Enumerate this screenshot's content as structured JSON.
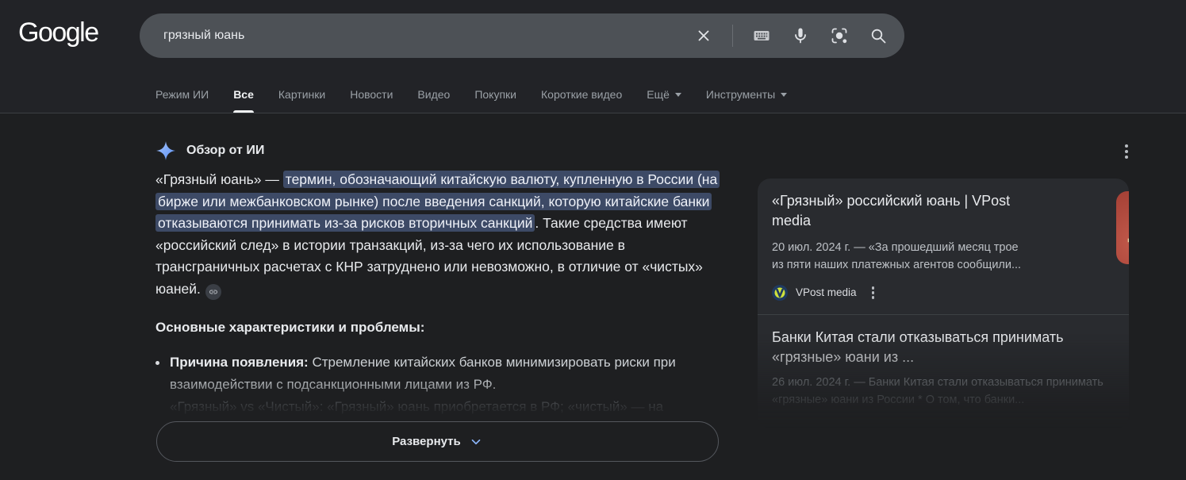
{
  "header": {
    "logo_text": "Google",
    "search_query": "грязный юань",
    "tabs": [
      {
        "label": "Режим ИИ",
        "active": false
      },
      {
        "label": "Все",
        "active": true
      },
      {
        "label": "Картинки",
        "active": false
      },
      {
        "label": "Новости",
        "active": false
      },
      {
        "label": "Видео",
        "active": false
      },
      {
        "label": "Покупки",
        "active": false
      },
      {
        "label": "Короткие видео",
        "active": false
      },
      {
        "label": "Ещё",
        "active": false,
        "dropdown": true
      },
      {
        "label": "Инструменты",
        "active": false,
        "dropdown": true
      }
    ],
    "icons": [
      "clear-icon",
      "keyboard-icon",
      "mic-icon",
      "lens-icon",
      "search-icon"
    ]
  },
  "ai_overview": {
    "title": "Обзор от ИИ",
    "intro_prefix": "«Грязный юань» — ",
    "highlight": "термин, обозначающий китайскую валюту, купленную в России (на бирже или межбанковском рынке) после введения санкций, которую китайские банки отказываются принимать из-за рисков вторичных санкций",
    "intro_suffix": ". Такие средства имеют «российский след» в истории транзакций, из-за чего их использование в трансграничных расчетах с КНР затруднено или невозможно, в отличие от «чистых» юаней.",
    "section_heading": "Основные характеристики и проблемы:",
    "bullet_lead": "Причина появления:",
    "bullet_text": " Стремление китайских банков минимизировать риски при взаимодействии с подсанкционными лицами из РФ.",
    "faded_line": "«Грязный» vs «Чистый»: «Грязный» юань приобретается в РФ; «чистый» — на",
    "expand_label": "Развернуть"
  },
  "results": [
    {
      "title": "«Грязный» российский юань | VPost media",
      "snippet": "20 июл. 2024 г. — «За прошедший месяц трое из пяти наших платежных агентов сообщили...",
      "source": "VPost media"
    },
    {
      "title": "Банки Китая стали отказываться принимать «грязные» юани из ...",
      "snippet": "26 июл. 2024 г. — Банки Китая стали отказываться принимать «грязные» юани из России * О том, что банки..."
    }
  ],
  "colors": {
    "accent_blue": "#8ab4f8",
    "highlight_bg": "#3d4a66",
    "header_bg": "#222327",
    "page_bg": "#1e1f21",
    "card_bg": "#292b2f",
    "searchbar_bg": "#4d5156"
  }
}
